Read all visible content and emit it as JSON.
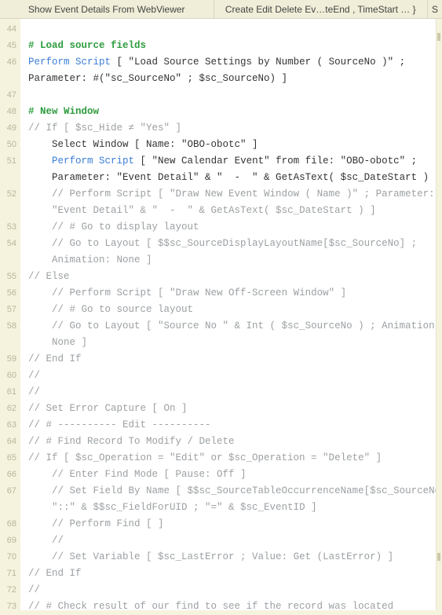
{
  "tabs": {
    "tab1": "Show Event Details From WebViewer",
    "tab2": "Create Edit Delete Ev…teEnd , TimeStart … }",
    "tab3": "S"
  },
  "lines": [
    {
      "n": 44,
      "indent": 0,
      "spans": []
    },
    {
      "n": 45,
      "indent": 0,
      "spans": [
        {
          "cls": "comment-green",
          "t": "# Load source fields"
        }
      ]
    },
    {
      "n": 46,
      "indent": 0,
      "spans": [
        {
          "cls": "keyword-blue",
          "t": "Perform Script"
        },
        {
          "cls": "string-normal",
          "t": " [ \"Load Source Settings by Number ( SourceNo )\" ; Parameter: #(\"sc_SourceNo\" ; $sc_SourceNo) ]"
        }
      ]
    },
    {
      "n": 47,
      "indent": 0,
      "spans": []
    },
    {
      "n": 48,
      "indent": 0,
      "spans": [
        {
          "cls": "comment-green",
          "t": "# New Window"
        }
      ]
    },
    {
      "n": 49,
      "indent": 0,
      "spans": [
        {
          "cls": "comment-gray",
          "t": "// If [ $sc_Hide ≠ \"Yes\" ]"
        }
      ]
    },
    {
      "n": 50,
      "indent": 1,
      "spans": [
        {
          "cls": "string-normal",
          "t": "Select Window [ Name: \"OBO-obotc\" ]"
        }
      ]
    },
    {
      "n": 51,
      "indent": 1,
      "spans": [
        {
          "cls": "keyword-blue",
          "t": "Perform Script"
        },
        {
          "cls": "string-normal",
          "t": " [ \"New Calendar Event\" from file: \"OBO-obotc\" ; Parameter: \"Event Detail\" & \"  -  \" & GetAsText( $sc_DateStart ) ]"
        }
      ]
    },
    {
      "n": 52,
      "indent": 1,
      "spans": [
        {
          "cls": "comment-gray",
          "t": "// Perform Script [ \"Draw New Event Window ( Name )\" ; Parameter: \"Event Detail\" & \"  -  \" & GetAsText( $sc_DateStart ) ]"
        }
      ]
    },
    {
      "n": 53,
      "indent": 1,
      "spans": [
        {
          "cls": "comment-gray",
          "t": "// # Go to display layout"
        }
      ]
    },
    {
      "n": 54,
      "indent": 1,
      "spans": [
        {
          "cls": "comment-gray",
          "t": "// Go to Layout [ $$sc_SourceDisplayLayoutName[$sc_SourceNo] ; Animation: None ]"
        }
      ]
    },
    {
      "n": 55,
      "indent": 0,
      "spans": [
        {
          "cls": "comment-gray",
          "t": "// Else"
        }
      ]
    },
    {
      "n": 56,
      "indent": 1,
      "spans": [
        {
          "cls": "comment-gray",
          "t": "// Perform Script [ \"Draw New Off-Screen Window\" ]"
        }
      ]
    },
    {
      "n": 57,
      "indent": 1,
      "spans": [
        {
          "cls": "comment-gray",
          "t": "// # Go to source layout"
        }
      ]
    },
    {
      "n": 58,
      "indent": 1,
      "spans": [
        {
          "cls": "comment-gray",
          "t": "// Go to Layout [ \"Source No \" & Int ( $sc_SourceNo ) ; Animation: None ]"
        }
      ]
    },
    {
      "n": 59,
      "indent": 0,
      "spans": [
        {
          "cls": "comment-gray",
          "t": "// End If"
        }
      ]
    },
    {
      "n": 60,
      "indent": 0,
      "spans": [
        {
          "cls": "comment-gray",
          "t": "// "
        }
      ]
    },
    {
      "n": 61,
      "indent": 0,
      "spans": [
        {
          "cls": "comment-gray",
          "t": "// "
        }
      ]
    },
    {
      "n": 62,
      "indent": 0,
      "spans": [
        {
          "cls": "comment-gray",
          "t": "// Set Error Capture [ On ]"
        }
      ]
    },
    {
      "n": 63,
      "indent": 0,
      "spans": [
        {
          "cls": "comment-gray",
          "t": "// # ---------- Edit ----------"
        }
      ]
    },
    {
      "n": 64,
      "indent": 0,
      "spans": [
        {
          "cls": "comment-gray",
          "t": "// # Find Record To Modify / Delete"
        }
      ]
    },
    {
      "n": 65,
      "indent": 0,
      "spans": [
        {
          "cls": "comment-gray",
          "t": "// If [ $sc_Operation = \"Edit\" or $sc_Operation = \"Delete\" ]"
        }
      ]
    },
    {
      "n": 66,
      "indent": 1,
      "spans": [
        {
          "cls": "comment-gray",
          "t": "// Enter Find Mode [ Pause: Off ]"
        }
      ]
    },
    {
      "n": 67,
      "indent": 1,
      "spans": [
        {
          "cls": "comment-gray",
          "t": "// Set Field By Name [ $$sc_SourceTableOccurrenceName[$sc_SourceNo] & \"::\" & $$sc_FieldForUID ; \"=\" & $sc_EventID ]"
        }
      ]
    },
    {
      "n": 68,
      "indent": 1,
      "spans": [
        {
          "cls": "comment-gray",
          "t": "// Perform Find [ ]"
        }
      ]
    },
    {
      "n": 69,
      "indent": 1,
      "spans": [
        {
          "cls": "comment-gray",
          "t": "// "
        }
      ]
    },
    {
      "n": 70,
      "indent": 1,
      "spans": [
        {
          "cls": "comment-gray",
          "t": "// Set Variable [ $sc_LastError ; Value: Get (LastError) ]"
        }
      ]
    },
    {
      "n": 71,
      "indent": 0,
      "spans": [
        {
          "cls": "comment-gray",
          "t": "// End If"
        }
      ]
    },
    {
      "n": 72,
      "indent": 0,
      "spans": [
        {
          "cls": "comment-gray",
          "t": "// "
        }
      ]
    },
    {
      "n": 73,
      "indent": 0,
      "spans": [
        {
          "cls": "comment-gray",
          "t": "// # Check result of our find to see if the record was located"
        }
      ]
    }
  ]
}
